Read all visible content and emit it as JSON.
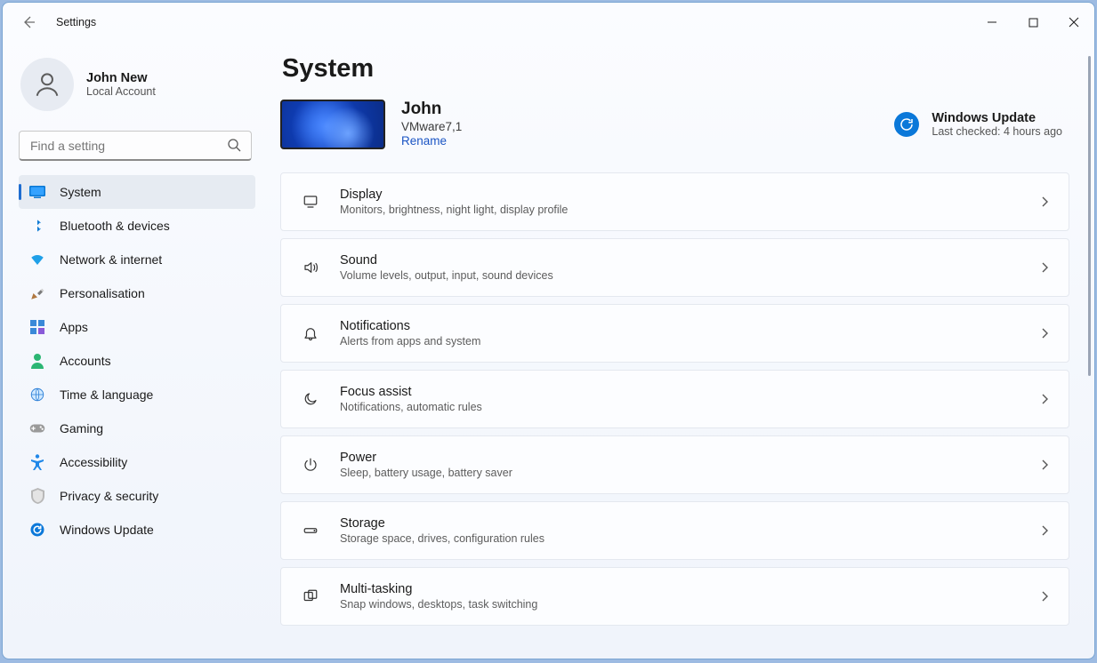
{
  "app": {
    "title": "Settings"
  },
  "user": {
    "name": "John New",
    "subtitle": "Local Account"
  },
  "search": {
    "placeholder": "Find a setting"
  },
  "sidebar": {
    "items": [
      {
        "label": "System",
        "icon": "system-icon",
        "selected": true
      },
      {
        "label": "Bluetooth & devices",
        "icon": "bluetooth-icon",
        "selected": false
      },
      {
        "label": "Network & internet",
        "icon": "wifi-icon",
        "selected": false
      },
      {
        "label": "Personalisation",
        "icon": "personalisation-icon",
        "selected": false
      },
      {
        "label": "Apps",
        "icon": "apps-icon",
        "selected": false
      },
      {
        "label": "Accounts",
        "icon": "accounts-icon",
        "selected": false
      },
      {
        "label": "Time & language",
        "icon": "time-language-icon",
        "selected": false
      },
      {
        "label": "Gaming",
        "icon": "gaming-icon",
        "selected": false
      },
      {
        "label": "Accessibility",
        "icon": "accessibility-icon",
        "selected": false
      },
      {
        "label": "Privacy & security",
        "icon": "privacy-icon",
        "selected": false
      },
      {
        "label": "Windows Update",
        "icon": "update-icon",
        "selected": false
      }
    ]
  },
  "page": {
    "title": "System",
    "device": {
      "name": "John",
      "model": "VMware7,1",
      "rename": "Rename"
    },
    "update": {
      "title": "Windows Update",
      "subtitle": "Last checked: 4 hours ago"
    },
    "cards": [
      {
        "title": "Display",
        "sub": "Monitors, brightness, night light, display profile",
        "icon": "display-icon"
      },
      {
        "title": "Sound",
        "sub": "Volume levels, output, input, sound devices",
        "icon": "sound-icon"
      },
      {
        "title": "Notifications",
        "sub": "Alerts from apps and system",
        "icon": "bell-icon"
      },
      {
        "title": "Focus assist",
        "sub": "Notifications, automatic rules",
        "icon": "moon-icon"
      },
      {
        "title": "Power",
        "sub": "Sleep, battery usage, battery saver",
        "icon": "power-icon"
      },
      {
        "title": "Storage",
        "sub": "Storage space, drives, configuration rules",
        "icon": "storage-icon"
      },
      {
        "title": "Multi-tasking",
        "sub": "Snap windows, desktops, task switching",
        "icon": "multitask-icon"
      }
    ]
  }
}
